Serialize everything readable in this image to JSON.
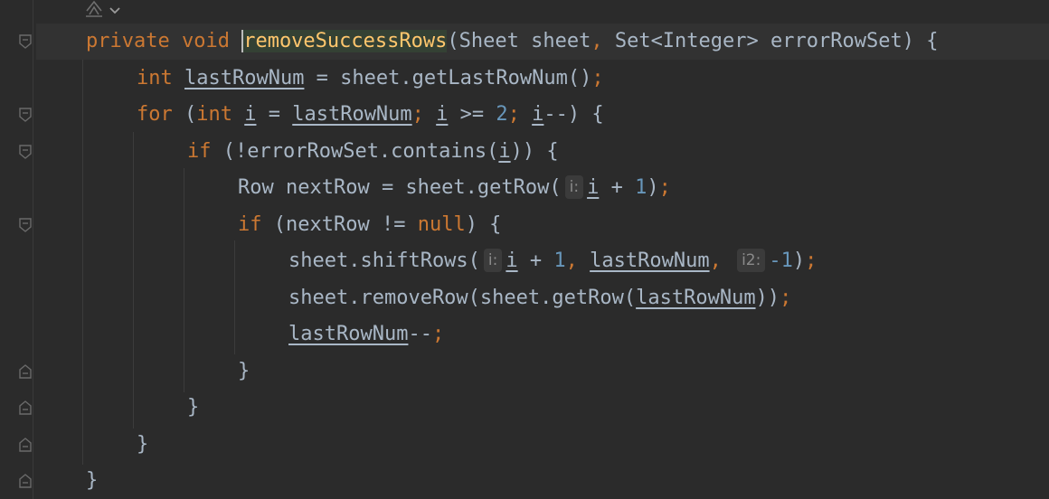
{
  "editor": {
    "top_icons": [
      "ai-assistant-icon",
      "chevron-down-icon"
    ],
    "lines": [
      {
        "tokens": [
          {
            "t": "private ",
            "c": "kw"
          },
          {
            "t": "void ",
            "c": "kw"
          },
          {
            "t": "removeSuccessRows",
            "c": "fn method-decl"
          },
          {
            "t": "(Sheet sheet",
            "c": ""
          },
          {
            "t": ", ",
            "c": "punc"
          },
          {
            "t": "Set<Integer> errorRowSet) {",
            "c": ""
          }
        ]
      },
      {
        "tokens": [
          {
            "t": "int ",
            "c": "kw"
          },
          {
            "t": "lastRowNum",
            "c": "ul"
          },
          {
            "t": " = sheet.getLastRowNum()",
            "c": ""
          },
          {
            "t": ";",
            "c": "punc"
          }
        ]
      },
      {
        "tokens": [
          {
            "t": "for ",
            "c": "kw"
          },
          {
            "t": "(",
            "c": ""
          },
          {
            "t": "int ",
            "c": "kw"
          },
          {
            "t": "i",
            "c": "ul"
          },
          {
            "t": " = ",
            "c": ""
          },
          {
            "t": "lastRowNum",
            "c": "ul"
          },
          {
            "t": "; ",
            "c": "punc"
          },
          {
            "t": "i",
            "c": "ul"
          },
          {
            "t": " >= ",
            "c": ""
          },
          {
            "t": "2",
            "c": "num"
          },
          {
            "t": "; ",
            "c": "punc"
          },
          {
            "t": "i",
            "c": "ul"
          },
          {
            "t": "--) {",
            "c": ""
          }
        ]
      },
      {
        "tokens": [
          {
            "t": "if ",
            "c": "kw"
          },
          {
            "t": "(!errorRowSet.contains(",
            "c": ""
          },
          {
            "t": "i",
            "c": "ul"
          },
          {
            "t": ")) {",
            "c": ""
          }
        ]
      },
      {
        "tokens": [
          {
            "t": "Row nextRow = sheet.getRow(",
            "c": ""
          },
          {
            "t": "i:",
            "c": "hint"
          },
          {
            "t": "i",
            "c": "ul"
          },
          {
            "t": " + ",
            "c": ""
          },
          {
            "t": "1",
            "c": "num"
          },
          {
            "t": ")",
            "c": ""
          },
          {
            "t": ";",
            "c": "punc"
          }
        ]
      },
      {
        "tokens": [
          {
            "t": "if ",
            "c": "kw"
          },
          {
            "t": "(nextRow != ",
            "c": ""
          },
          {
            "t": "null",
            "c": "kw"
          },
          {
            "t": ") {",
            "c": ""
          }
        ]
      },
      {
        "tokens": [
          {
            "t": "sheet.shiftRows(",
            "c": ""
          },
          {
            "t": "i:",
            "c": "hint"
          },
          {
            "t": "i",
            "c": "ul"
          },
          {
            "t": " + ",
            "c": ""
          },
          {
            "t": "1",
            "c": "num"
          },
          {
            "t": ", ",
            "c": "punc"
          },
          {
            "t": "lastRowNum",
            "c": "ul"
          },
          {
            "t": ", ",
            "c": "punc"
          },
          {
            "t": "i2:",
            "c": "hint"
          },
          {
            "t": "-1",
            "c": "num"
          },
          {
            "t": ")",
            "c": ""
          },
          {
            "t": ";",
            "c": "punc"
          }
        ]
      },
      {
        "tokens": [
          {
            "t": "sheet.removeRow(sheet.getRow(",
            "c": ""
          },
          {
            "t": "lastRowNum",
            "c": "ul"
          },
          {
            "t": "))",
            "c": ""
          },
          {
            "t": ";",
            "c": "punc"
          }
        ]
      },
      {
        "tokens": [
          {
            "t": "lastRowNum",
            "c": "ul"
          },
          {
            "t": "--",
            "c": ""
          },
          {
            "t": ";",
            "c": "punc"
          }
        ]
      },
      {
        "tokens": [
          {
            "t": "}",
            "c": ""
          }
        ]
      },
      {
        "tokens": [
          {
            "t": "}",
            "c": ""
          }
        ]
      },
      {
        "tokens": [
          {
            "t": "}",
            "c": ""
          }
        ]
      },
      {
        "tokens": [
          {
            "t": "}",
            "c": ""
          }
        ]
      }
    ]
  },
  "gutter": {
    "fold_markers": [
      {
        "line": 0,
        "kind": "fold-open-icon"
      },
      {
        "line": 2,
        "kind": "fold-open-icon"
      },
      {
        "line": 3,
        "kind": "fold-open-icon"
      },
      {
        "line": 5,
        "kind": "fold-open-icon"
      },
      {
        "line": 9,
        "kind": "fold-close-icon"
      },
      {
        "line": 10,
        "kind": "fold-close-icon"
      },
      {
        "line": 11,
        "kind": "fold-close-icon"
      },
      {
        "line": 12,
        "kind": "fold-close-icon"
      }
    ]
  },
  "colors": {
    "background": "#2b2b2b",
    "keyword": "#cc7832",
    "method": "#ffc66d",
    "number": "#6897bb",
    "text": "#a9b7c6"
  }
}
